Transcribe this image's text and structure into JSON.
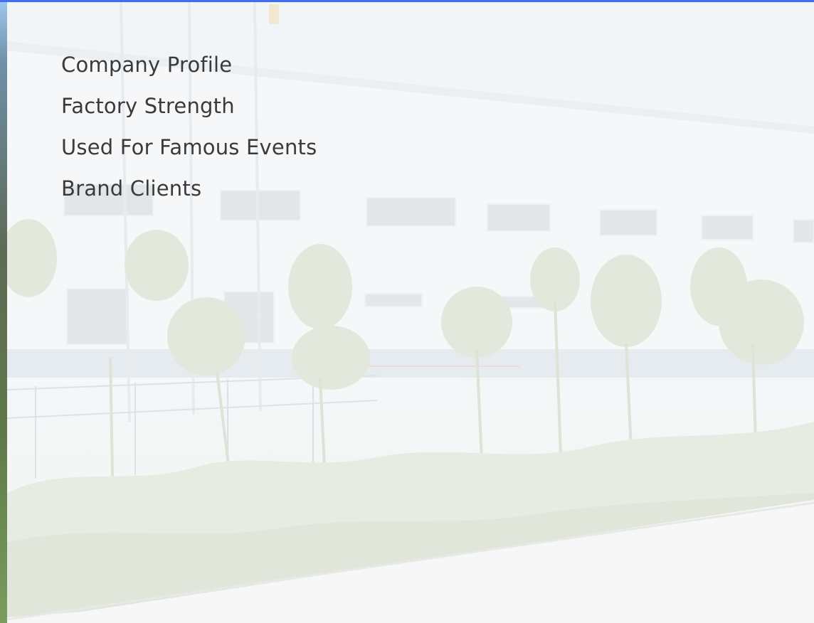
{
  "theme": {
    "accent": "#3d6ef5",
    "text": "#3a3a3a"
  },
  "menu": {
    "items": [
      {
        "label": "Company Profile"
      },
      {
        "label": "Factory Strength"
      },
      {
        "label": "Used For Famous Events"
      },
      {
        "label": "Brand Clients"
      }
    ]
  },
  "backdrop": {
    "subject": "factory-building-photo",
    "overlay": "white-wash"
  }
}
